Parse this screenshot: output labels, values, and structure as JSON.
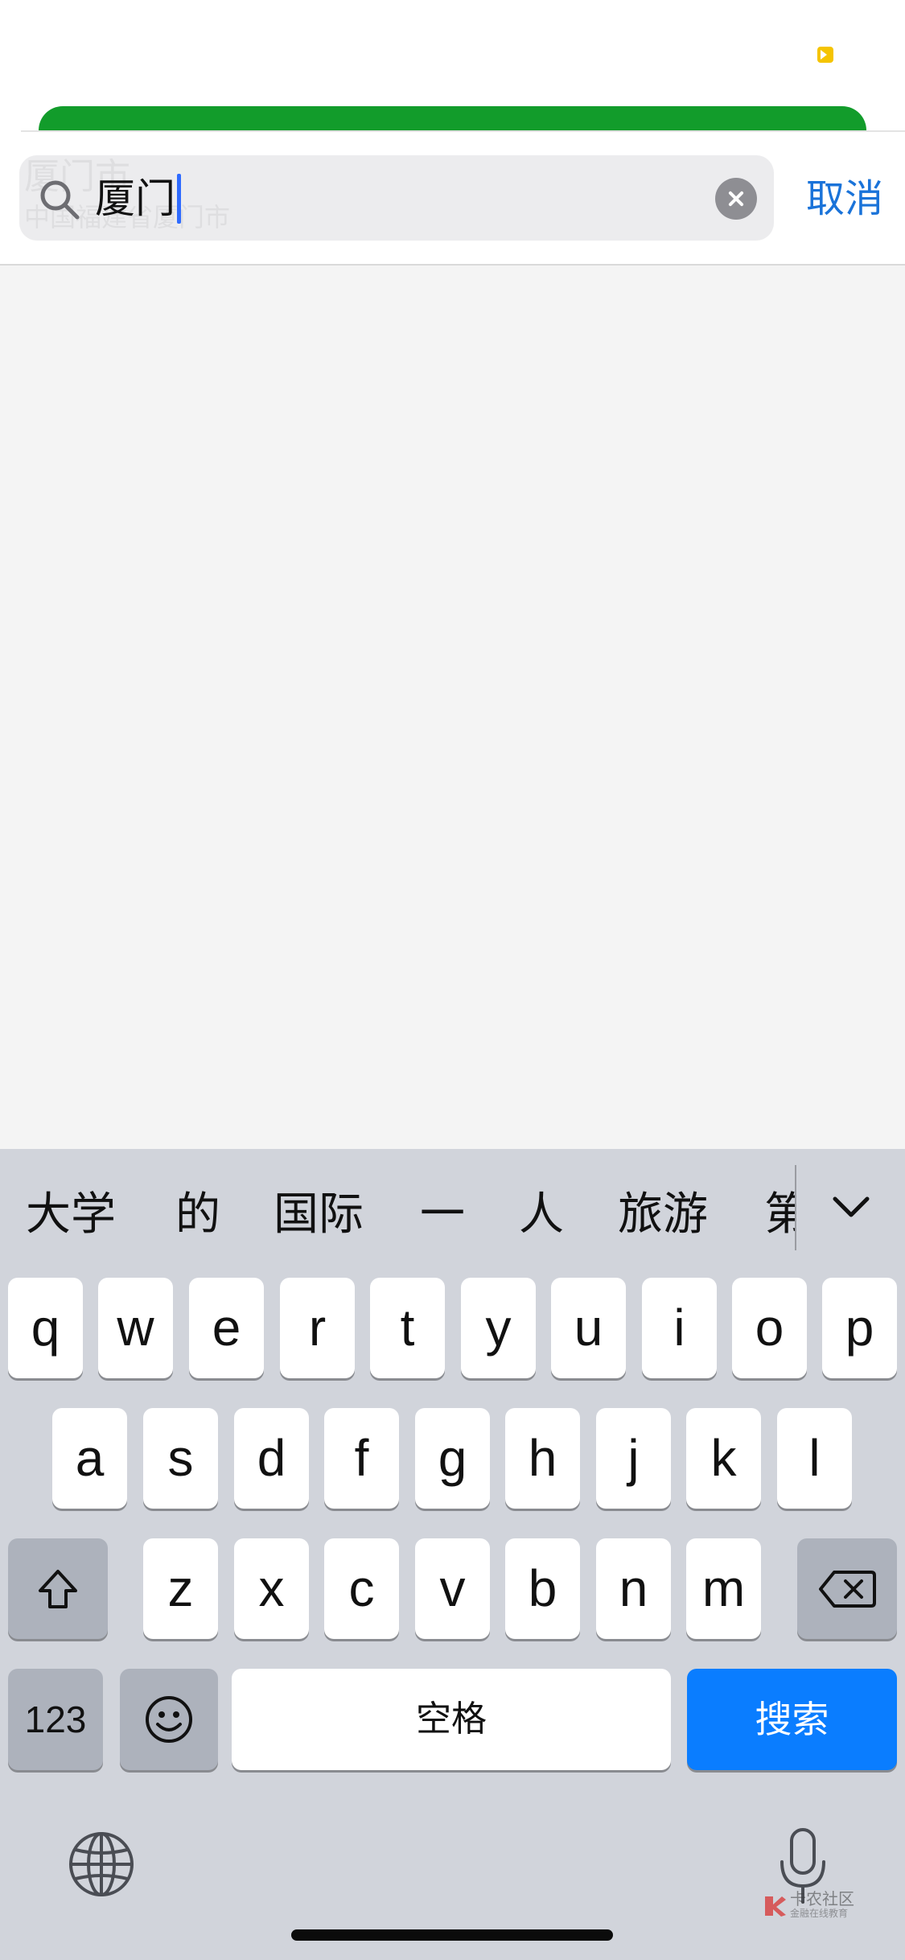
{
  "search": {
    "value": "厦门",
    "ghost_title": "厦门市",
    "ghost_subtitle": "中国福建省厦门市",
    "cancel_label": "取消"
  },
  "keyboard": {
    "candidates": [
      "大学",
      "的",
      "国际",
      "一",
      "人",
      "旅游"
    ],
    "candidate_partial": "第",
    "row1": [
      "q",
      "w",
      "e",
      "r",
      "t",
      "y",
      "u",
      "i",
      "o",
      "p"
    ],
    "row2": [
      "a",
      "s",
      "d",
      "f",
      "g",
      "h",
      "j",
      "k",
      "l"
    ],
    "row3": [
      "z",
      "x",
      "c",
      "v",
      "b",
      "n",
      "m"
    ],
    "numbers_label": "123",
    "space_label": "空格",
    "search_label": "搜索"
  },
  "watermark": {
    "name": "卡农社区",
    "tagline": "金融在线教育"
  },
  "colors": {
    "accent_blue": "#0a7dff",
    "link_blue": "#1a73d9",
    "banner_green": "#129c2b",
    "indicator_yellow": "#f5c400"
  }
}
